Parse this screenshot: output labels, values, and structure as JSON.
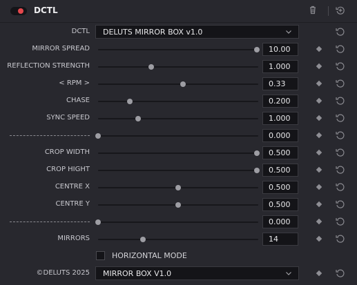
{
  "header": {
    "title": "DCTL",
    "enabled": true,
    "delete_icon": "trash-icon",
    "add_icon": "plus-history-icon"
  },
  "dctl_row": {
    "label": "DCTL",
    "selected": "DELUTS MIRROR BOX v1.0"
  },
  "sliders": [
    {
      "name": "mirror-spread",
      "label": "MIRROR SPREAD",
      "value": "10.00",
      "fraction": 0.99
    },
    {
      "name": "reflection-strength",
      "label": "REFLECTION STRENGTH",
      "value": "1.000",
      "fraction": 0.33
    },
    {
      "name": "rpm",
      "label": "< RPM >",
      "value": "0.33",
      "fraction": 0.53
    },
    {
      "name": "chase",
      "label": "CHASE",
      "value": "0.200",
      "fraction": 0.2
    },
    {
      "name": "sync-speed",
      "label": "SYNC SPEED",
      "value": "1.000",
      "fraction": 0.25
    },
    {
      "name": "separator-1",
      "label": "------------------------------",
      "value": "0.000",
      "fraction": 0.0
    },
    {
      "name": "crop-width",
      "label": "CROP WIDTH",
      "value": "0.500",
      "fraction": 0.99
    },
    {
      "name": "crop-hight",
      "label": "CROP HIGHT",
      "value": "0.500",
      "fraction": 0.99
    },
    {
      "name": "centre-x",
      "label": "CENTRE X",
      "value": "0.500",
      "fraction": 0.5
    },
    {
      "name": "centre-y",
      "label": "CENTRE Y",
      "value": "0.500",
      "fraction": 0.5
    },
    {
      "name": "separator-2",
      "label": "------------------------------",
      "value": "0.000",
      "fraction": 0.0
    },
    {
      "name": "mirrors",
      "label": "MIRRORS",
      "value": "14",
      "fraction": 0.28
    }
  ],
  "checkbox": {
    "label": "HORIZONTAL MODE",
    "checked": false
  },
  "footer": {
    "label": "©DELUTS 2025",
    "selected": "MIRROR BOX V1.0"
  },
  "colors": {
    "toggle_on": "#e5484d",
    "background": "#28282e"
  }
}
